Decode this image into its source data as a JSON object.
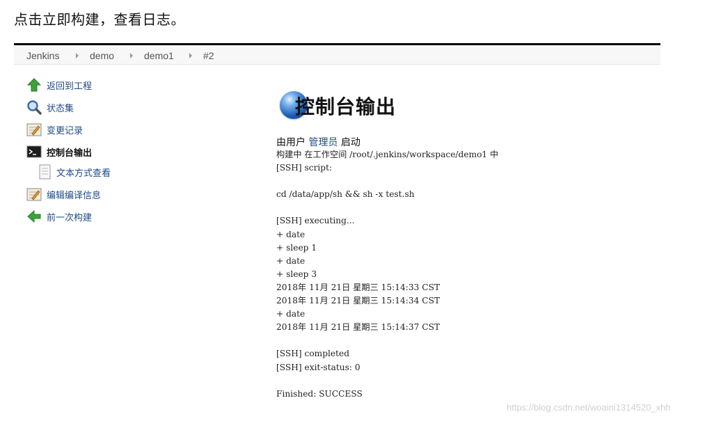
{
  "caption": "点击立即构建，查看日志。",
  "breadcrumb": [
    "Jenkins",
    "demo",
    "demo1",
    "#2"
  ],
  "sidebar": {
    "items": [
      {
        "label": "返回到工程",
        "icon": "up-arrow-icon"
      },
      {
        "label": "状态集",
        "icon": "magnifier-icon"
      },
      {
        "label": "变更记录",
        "icon": "notepad-icon"
      },
      {
        "label": "控制台输出",
        "icon": "terminal-icon"
      },
      {
        "label": "文本方式查看",
        "icon": "document-icon"
      },
      {
        "label": "编辑编译信息",
        "icon": "notepad-icon"
      },
      {
        "label": "前一次构建",
        "icon": "left-arrow-icon"
      }
    ]
  },
  "console": {
    "title": "控制台输出",
    "started_prefix": "由用户",
    "started_user": "管理员",
    "started_suffix": "启动",
    "lines": [
      "构建中 在工作空间 /root/.jenkins/workspace/demo1 中",
      "[SSH] script:",
      "",
      "cd /data/app/sh && sh -x test.sh",
      "",
      "[SSH] executing...",
      "+ date",
      "+ sleep 1",
      "+ date",
      "+ sleep 3",
      "2018年 11月 21日 星期三 15:14:33 CST",
      "2018年 11月 21日 星期三 15:14:34 CST",
      "+ date",
      "2018年 11月 21日 星期三 15:14:37 CST",
      "",
      "[SSH] completed",
      "[SSH] exit-status: 0",
      "",
      "Finished: SUCCESS"
    ]
  },
  "watermark": "https://blog.csdn.net/woaini1314520_xhh"
}
